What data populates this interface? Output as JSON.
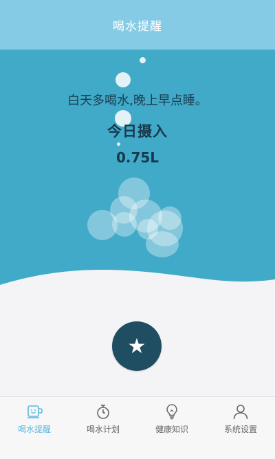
{
  "header": {
    "title": "喝水提醒"
  },
  "main": {
    "slogan": "白天多喝水,晚上早点睡。",
    "intake_label": "今日摄入",
    "intake_value": "0.75L",
    "action_icon": "star-icon",
    "action_glyph": "★"
  },
  "colors": {
    "title_bar": "#86cbe6",
    "hero": "#41aac9",
    "accent": "#5ab8dc",
    "button": "#1f4e63"
  },
  "tabs": [
    {
      "label": "喝水提醒",
      "icon": "cup-icon",
      "active": true
    },
    {
      "label": "喝水计划",
      "icon": "stopwatch-icon",
      "active": false
    },
    {
      "label": "健康知识",
      "icon": "lightbulb-icon",
      "active": false
    },
    {
      "label": "系统设置",
      "icon": "user-icon",
      "active": false
    }
  ]
}
